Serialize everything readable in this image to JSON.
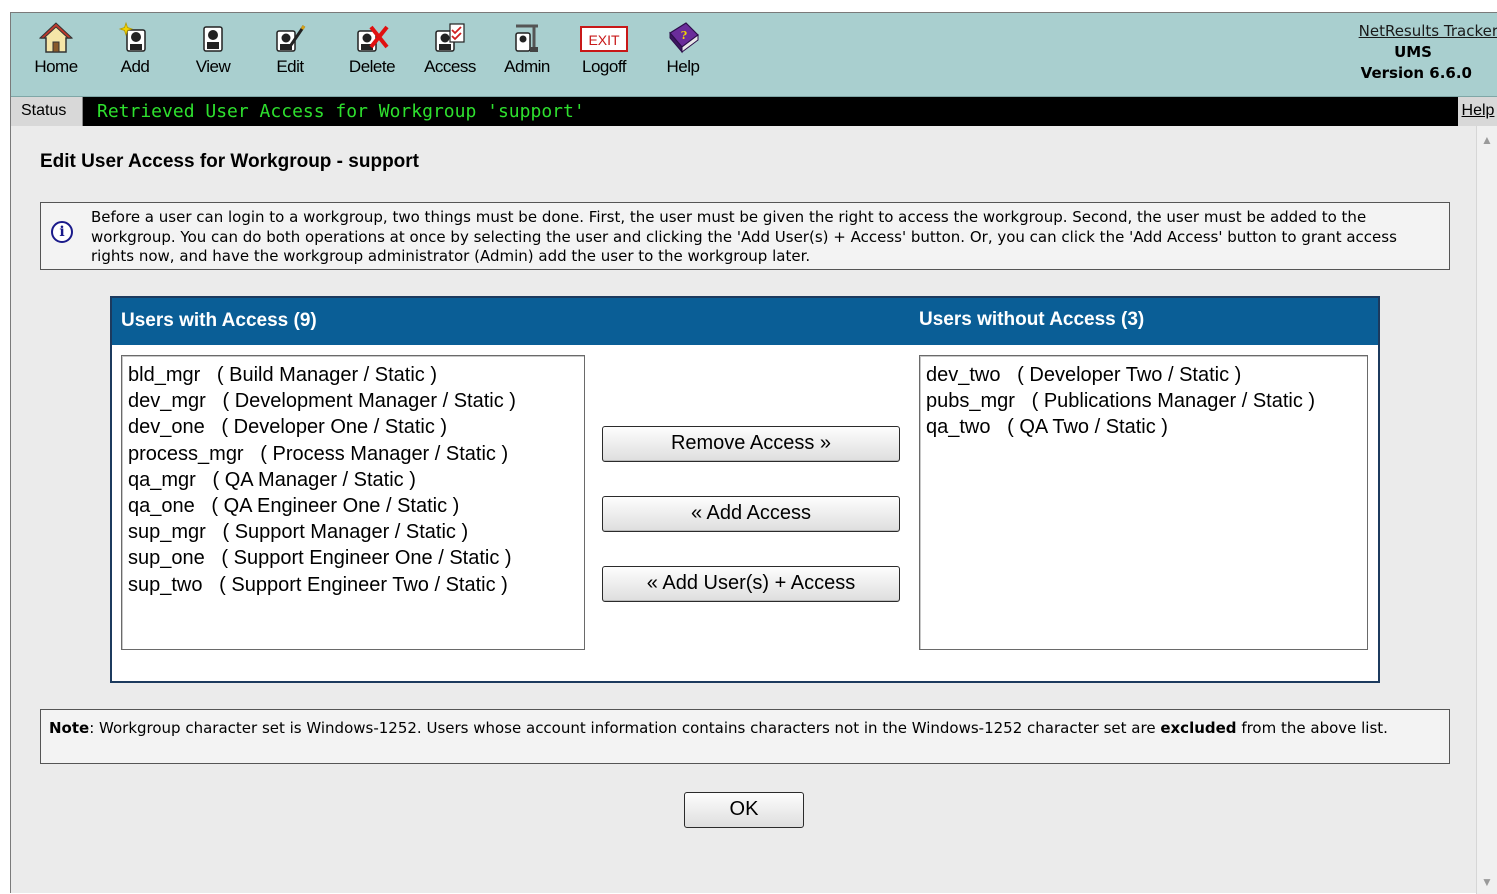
{
  "toolbar": {
    "items": [
      {
        "label": "Home",
        "icon": "home-icon"
      },
      {
        "label": "Add",
        "icon": "add-user-icon"
      },
      {
        "label": "View",
        "icon": "view-user-icon"
      },
      {
        "label": "Edit",
        "icon": "edit-user-icon"
      },
      {
        "label": "Delete",
        "icon": "delete-user-icon"
      },
      {
        "label": "Access",
        "icon": "access-icon"
      },
      {
        "label": "Admin",
        "icon": "admin-tools-icon"
      },
      {
        "label": "Logoff",
        "icon": "exit-sign-icon",
        "icon_text": "EXIT"
      },
      {
        "label": "Help",
        "icon": "help-book-icon"
      }
    ]
  },
  "brand": {
    "product": "NetResults Tracker",
    "module": "UMS",
    "version": "Version 6.6.0"
  },
  "status": {
    "label": "Status",
    "message": "Retrieved User Access for Workgroup 'support'",
    "help": "Help",
    "message_color": "#2ee02e"
  },
  "page": {
    "title": "Edit User Access for Workgroup - support",
    "info": "Before a user can login to a workgroup, two things must be done. First, the user must be given the right to access the workgroup. Second, the user must be added to the workgroup. You can do both operations at once by selecting the user and clicking the 'Add User(s) + Access' button. Or, you can click the 'Add Access' button to grant access rights now, and have the workgroup administrator (Admin) add the user to the workgroup later."
  },
  "access": {
    "with_header": "Users with Access (9)",
    "without_header": "Users without Access (3)",
    "with_users": [
      "bld_mgr   ( Build Manager / Static )",
      "dev_mgr   ( Development Manager / Static )",
      "dev_one   ( Developer One / Static )",
      "process_mgr   ( Process Manager / Static )",
      "qa_mgr   ( QA Manager / Static )",
      "qa_one   ( QA Engineer One / Static )",
      "sup_mgr   ( Support Manager / Static )",
      "sup_one   ( Support Engineer One / Static )",
      "sup_two   ( Support Engineer Two / Static )"
    ],
    "without_users": [
      "dev_two   ( Developer Two / Static )",
      "pubs_mgr   ( Publications Manager / Static )",
      "qa_two   ( QA Two / Static )"
    ],
    "remove_label": "Remove Access »",
    "add_label": "« Add Access",
    "add_user_label": "« Add User(s) + Access"
  },
  "note": {
    "lead": "Note",
    "text1": ": Workgroup character set is Windows-1252. Users whose account information contains characters not in the Windows-1252 character set are ",
    "bold": "excluded",
    "text2": " from the above list."
  },
  "ok_label": "OK",
  "colors": {
    "toolbar_bg": "#a9cfcf",
    "panel_header": "#0a5e96",
    "content_bg": "#ebebeb"
  }
}
